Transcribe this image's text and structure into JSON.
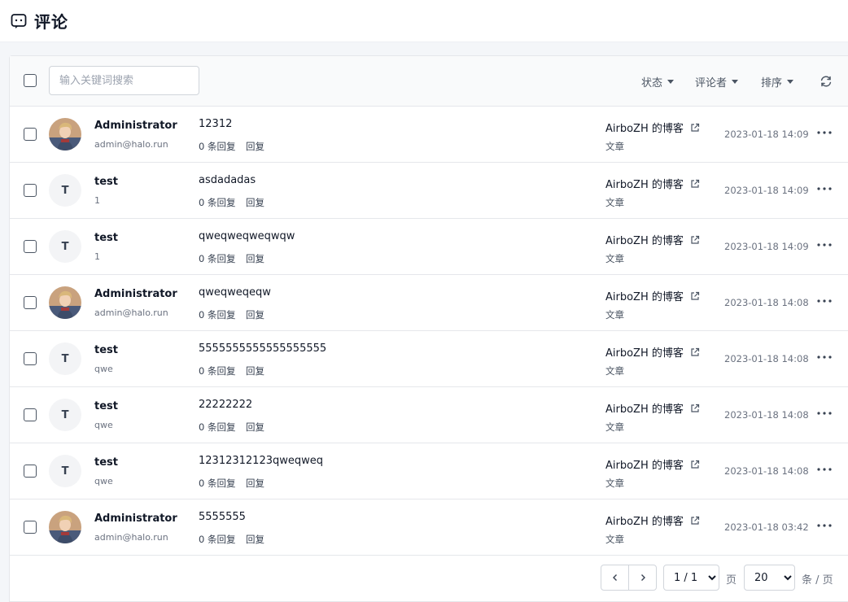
{
  "header": {
    "title": "评论"
  },
  "toolbar": {
    "search_placeholder": "输入关键词搜索",
    "filters": {
      "status": "状态",
      "commenter": "评论者",
      "sort": "排序"
    }
  },
  "rows": [
    {
      "avatar_type": "image",
      "avatar_letter": "",
      "name": "Administrator",
      "meta": "admin@halo.run",
      "content": "12312",
      "reply_count": "0 条回复",
      "reply": "回复",
      "subject": "AirboZH 的博客",
      "subject_type": "文章",
      "time": "2023-01-18 14:09"
    },
    {
      "avatar_type": "letter",
      "avatar_letter": "T",
      "name": "test",
      "meta": "1",
      "content": "asdadadas",
      "reply_count": "0 条回复",
      "reply": "回复",
      "subject": "AirboZH 的博客",
      "subject_type": "文章",
      "time": "2023-01-18 14:09"
    },
    {
      "avatar_type": "letter",
      "avatar_letter": "T",
      "name": "test",
      "meta": "1",
      "content": "qweqweqweqwqw",
      "reply_count": "0 条回复",
      "reply": "回复",
      "subject": "AirboZH 的博客",
      "subject_type": "文章",
      "time": "2023-01-18 14:09"
    },
    {
      "avatar_type": "image",
      "avatar_letter": "",
      "name": "Administrator",
      "meta": "admin@halo.run",
      "content": "qweqweqeqw",
      "reply_count": "0 条回复",
      "reply": "回复",
      "subject": "AirboZH 的博客",
      "subject_type": "文章",
      "time": "2023-01-18 14:08"
    },
    {
      "avatar_type": "letter",
      "avatar_letter": "T",
      "name": "test",
      "meta": "qwe",
      "content": "5555555555555555555",
      "reply_count": "0 条回复",
      "reply": "回复",
      "subject": "AirboZH 的博客",
      "subject_type": "文章",
      "time": "2023-01-18 14:08"
    },
    {
      "avatar_type": "letter",
      "avatar_letter": "T",
      "name": "test",
      "meta": "qwe",
      "content": "22222222",
      "reply_count": "0 条回复",
      "reply": "回复",
      "subject": "AirboZH 的博客",
      "subject_type": "文章",
      "time": "2023-01-18 14:08"
    },
    {
      "avatar_type": "letter",
      "avatar_letter": "T",
      "name": "test",
      "meta": "qwe",
      "content": "12312312123qweqweq",
      "reply_count": "0 条回复",
      "reply": "回复",
      "subject": "AirboZH 的博客",
      "subject_type": "文章",
      "time": "2023-01-18 14:08"
    },
    {
      "avatar_type": "image",
      "avatar_letter": "",
      "name": "Administrator",
      "meta": "admin@halo.run",
      "content": "5555555",
      "reply_count": "0 条回复",
      "reply": "回复",
      "subject": "AirboZH 的博客",
      "subject_type": "文章",
      "time": "2023-01-18 03:42"
    }
  ],
  "pagination": {
    "page_value": "1 / 1",
    "page_label": "页",
    "size_value": "20",
    "size_label": "条 / 页"
  },
  "icons": {
    "header": "comment-icon",
    "refresh": "refresh-icon",
    "external": "external-link-icon",
    "more": "more-horizontal-icon",
    "prev": "chevron-left-icon",
    "next": "chevron-right-icon"
  }
}
